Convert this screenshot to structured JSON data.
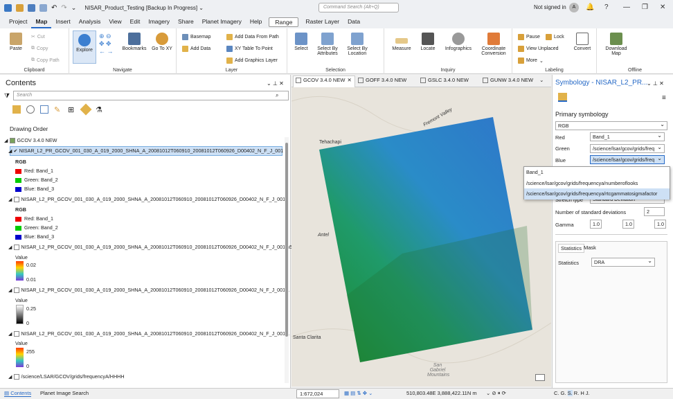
{
  "titlebar": {
    "title": "NISAR_Product_Testing [Backup In Progress]  ⌄",
    "command_search": "Command Search (Alt+Q)",
    "signin": "Not signed in",
    "avatar": "A"
  },
  "menu": {
    "items": [
      "Project",
      "Map",
      "Insert",
      "Analysis",
      "View",
      "Edit",
      "Imagery",
      "Share",
      "Planet Imagery",
      "Help"
    ],
    "contextual": [
      "Range",
      "Raster Layer",
      "Data"
    ]
  },
  "ribbon": {
    "clipboard": {
      "label": "Clipboard",
      "paste": "Paste",
      "cut": "Cut",
      "copy": "Copy",
      "copy_path": "Copy Path"
    },
    "navigate": {
      "label": "Navigate",
      "explore": "Explore",
      "bookmarks": "Bookmarks",
      "goto": "Go To XY"
    },
    "layer": {
      "label": "Layer",
      "basemap": "Basemap",
      "add_data": "Add Data",
      "add_from_path": "Add Data From Path",
      "xy_table": "XY Table To Point",
      "add_graphics": "Add Graphics Layer"
    },
    "selection": {
      "label": "Selection",
      "select": "Select",
      "by_attr": "Select By Attributes",
      "by_loc": "Select By Location"
    },
    "inquiry": {
      "label": "Inquiry",
      "measure": "Measure",
      "locate": "Locate",
      "infographics": "Infographics",
      "coord": "Coordinate Conversion"
    },
    "labeling": {
      "label": "Labeling",
      "pause": "Pause",
      "lock": "Lock",
      "view_unplaced": "View Unplaced",
      "more": "More",
      "convert": "Convert"
    },
    "offline": {
      "label": "Offline",
      "download": "Download Map"
    }
  },
  "contents": {
    "title": "Contents",
    "search_placeholder": "Search",
    "drawing_order": "Drawing Order",
    "map_name": "GCOV 3.4.0 NEW",
    "layer1": "NISAR_L2_PR_GCOV_001_030_A_019_2000_SHNA_A_20081012T060910_20081012T060926_D00402_N_F_J_001",
    "rgb1": "RGB",
    "red1": "Red:  Band_1",
    "green1": "Green: Band_2",
    "blue1": "Blue:  Band_3",
    "layer2": "NISAR_L2_PR_GCOV_001_030_A_019_2000_SHNA_A_20081012T060910_20081012T060926_D00402_N_F_J_001",
    "rgb2": "RGB",
    "red2": "Red:  Band_1",
    "green2": "Green: Band_2",
    "blue2": "Blue:  Band_3",
    "layer3": "NISAR_L2_PR_GCOV_001_030_A_019_2000_SHNA_A_20081012T060910_20081012T060926_D00402_N_F_J_001.h5",
    "value3": "Value",
    "max3": "0.02",
    "min3": "0.01",
    "layer4": "NISAR_L2_PR_GCOV_001_030_A_019_2000_SHNA_A_20081012T060910_20081012T060926_D00402_N_F_J_001...",
    "value4": "Value",
    "max4": "0.25",
    "min4": "0",
    "layer5": "NISAR_L2_PR_GCOV_001_030_A_019_2000_SHNA_A_20081012T060910_20081012T060926_D00402_N_F_J_001...",
    "value5": "Value",
    "max5": "255",
    "min5": "0",
    "layer6": "/science/LSAR/GCOV/grids/frequencyA/HHHH"
  },
  "map": {
    "tabs": [
      "GCOV 3.4.0 NEW",
      "GOFF 3.4.0 NEW",
      "GSLC 3.4.0 NEW",
      "GUNW 3.4.0 NEW"
    ],
    "places": {
      "tehachapi": "Tehachapi",
      "santa_clarita": "Santa Clarita",
      "antelope": "Antel",
      "fremont": "Fremont Valley",
      "san_gabriel": "San Gabriel Mountains"
    },
    "scale": "1:672,024",
    "coords": "510,803.48E 3,888,422.11N m"
  },
  "status": {
    "tab1": "Contents",
    "tab2": "Planet Image Search"
  },
  "symbology": {
    "title": "Symbology - NISAR_L2_PR...",
    "primary": "Primary symbology",
    "renderer": "RGB",
    "red_label": "Red",
    "red_value": "Band_1",
    "green_label": "Green",
    "green_value": "/science/lsar/gcov/grids/freq",
    "blue_label": "Blue",
    "blue_value": "/science/lsar/gcov/grids/freq",
    "stretch_label": "Stretch type",
    "stretch_value": "Standard Deviation",
    "nstd_label": "Number of standard deviations",
    "nstd_value": "2",
    "gamma_label": "Gamma",
    "gamma": [
      "1.0",
      "1.0",
      "1.0"
    ],
    "tab_statistics": "Statistics",
    "tab_mask": "Mask",
    "statistics_label": "Statistics",
    "statistics_value": "DRA",
    "bottom_tabs": [
      "C.",
      "G.",
      "S.",
      "R.",
      "H",
      "J."
    ]
  },
  "dropdown": {
    "options": [
      "Band_1",
      "/science/lsar/gcov/grids/frequencya/numberoflooks",
      "/science/lsar/gcov/grids/frequencya/rtcgammatosigmafactor"
    ]
  }
}
